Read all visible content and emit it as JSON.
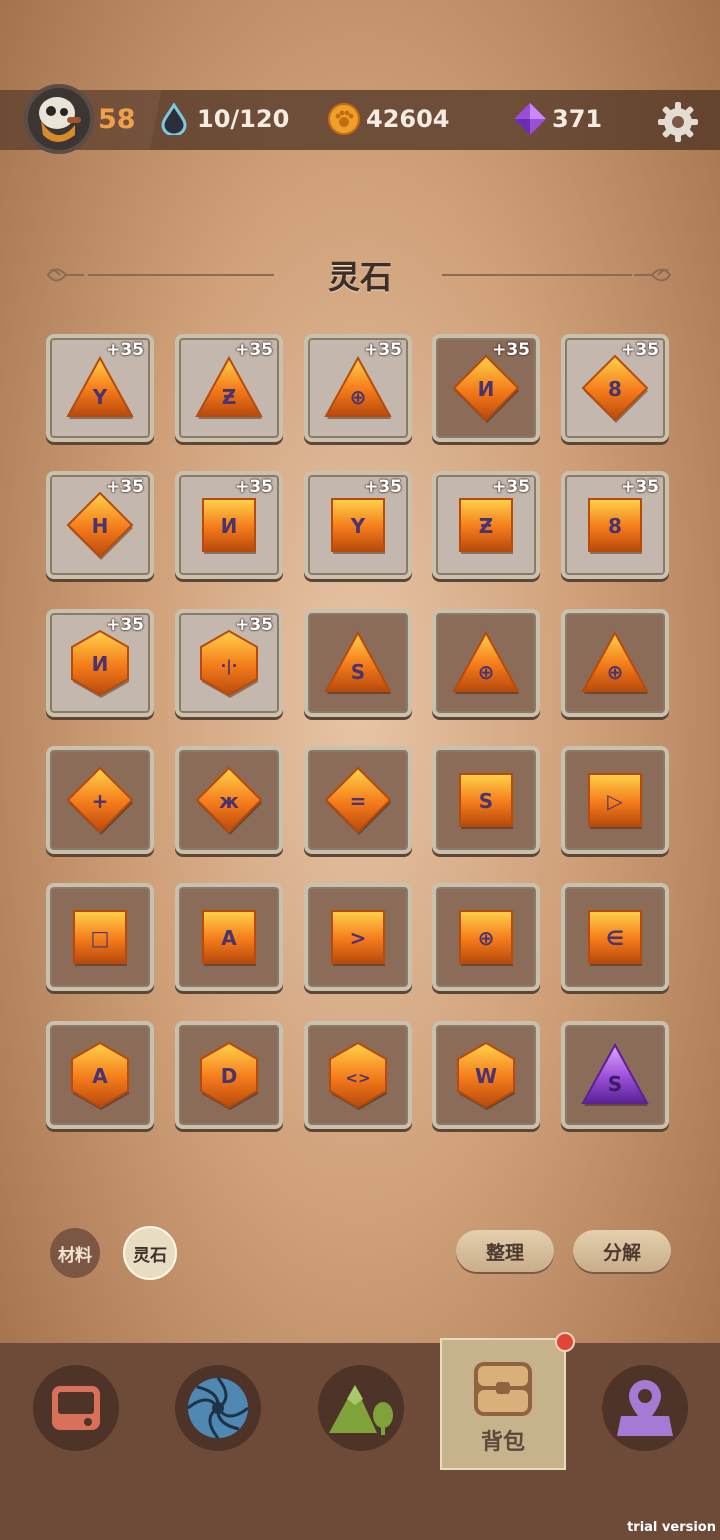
{
  "header": {
    "level": "58",
    "stamina": "10/120",
    "coins": "42604",
    "gems": "371"
  },
  "section_title": "灵石",
  "slots": [
    {
      "shape": "triangle",
      "rune": "Y",
      "bonus": "+35",
      "bg": "light",
      "color": "orange"
    },
    {
      "shape": "triangle",
      "rune": "Ƶ",
      "bonus": "+35",
      "bg": "light",
      "color": "orange"
    },
    {
      "shape": "triangle",
      "rune": "⊕",
      "bonus": "+35",
      "bg": "light",
      "color": "orange"
    },
    {
      "shape": "diamond",
      "rune": "И",
      "bonus": "+35",
      "bg": "dark",
      "color": "orange"
    },
    {
      "shape": "diamond",
      "rune": "8",
      "bonus": "+35",
      "bg": "light",
      "color": "orange"
    },
    {
      "shape": "diamond",
      "rune": "H",
      "bonus": "+35",
      "bg": "light",
      "color": "orange"
    },
    {
      "shape": "square",
      "rune": "И",
      "bonus": "+35",
      "bg": "light",
      "color": "orange"
    },
    {
      "shape": "square",
      "rune": "Y",
      "bonus": "+35",
      "bg": "light",
      "color": "orange"
    },
    {
      "shape": "square",
      "rune": "Ƶ",
      "bonus": "+35",
      "bg": "light",
      "color": "orange"
    },
    {
      "shape": "square",
      "rune": "8",
      "bonus": "+35",
      "bg": "light",
      "color": "orange"
    },
    {
      "shape": "hexagon",
      "rune": "И",
      "bonus": "+35",
      "bg": "light",
      "color": "orange"
    },
    {
      "shape": "hexagon",
      "rune": "·|·",
      "bonus": "+35",
      "bg": "light",
      "color": "orange"
    },
    {
      "shape": "triangle",
      "rune": "S",
      "bonus": "",
      "bg": "dark",
      "color": "orange"
    },
    {
      "shape": "triangle",
      "rune": "⊕",
      "bonus": "",
      "bg": "dark",
      "color": "orange"
    },
    {
      "shape": "triangle",
      "rune": "⊕",
      "bonus": "",
      "bg": "dark",
      "color": "orange"
    },
    {
      "shape": "diamond",
      "rune": "+",
      "bonus": "",
      "bg": "dark",
      "color": "orange"
    },
    {
      "shape": "diamond",
      "rune": "ж",
      "bonus": "",
      "bg": "dark",
      "color": "orange"
    },
    {
      "shape": "diamond",
      "rune": "=",
      "bonus": "",
      "bg": "dark",
      "color": "orange"
    },
    {
      "shape": "square",
      "rune": "S",
      "bonus": "",
      "bg": "dark",
      "color": "orange"
    },
    {
      "shape": "square",
      "rune": "▷",
      "bonus": "",
      "bg": "dark",
      "color": "orange"
    },
    {
      "shape": "square",
      "rune": "□",
      "bonus": "",
      "bg": "dark",
      "color": "orange"
    },
    {
      "shape": "square",
      "rune": "A",
      "bonus": "",
      "bg": "dark",
      "color": "orange"
    },
    {
      "shape": "square",
      "rune": ">",
      "bonus": "",
      "bg": "dark",
      "color": "orange"
    },
    {
      "shape": "square",
      "rune": "⊕",
      "bonus": "",
      "bg": "dark",
      "color": "orange"
    },
    {
      "shape": "square",
      "rune": "∈",
      "bonus": "",
      "bg": "dark",
      "color": "orange"
    },
    {
      "shape": "hexagon",
      "rune": "A",
      "bonus": "",
      "bg": "dark",
      "color": "orange"
    },
    {
      "shape": "hexagon",
      "rune": "D",
      "bonus": "",
      "bg": "dark",
      "color": "orange"
    },
    {
      "shape": "hexagon",
      "rune": "<>",
      "bonus": "",
      "bg": "dark",
      "color": "orange"
    },
    {
      "shape": "hexagon",
      "rune": "W",
      "bonus": "",
      "bg": "dark",
      "color": "orange"
    },
    {
      "shape": "triangle",
      "rune": "S",
      "bonus": "",
      "bg": "dark",
      "color": "purple"
    }
  ],
  "categories": {
    "materials": "材料",
    "spirit_stones": "灵石"
  },
  "actions": {
    "sort": "整理",
    "decompose": "分解"
  },
  "nav": {
    "bag_label": "背包"
  },
  "watermark": "trial version",
  "colors": {
    "gem_orange": "#f47a1a",
    "gem_purple": "#9a4fd8",
    "rune": "#4a3470"
  }
}
